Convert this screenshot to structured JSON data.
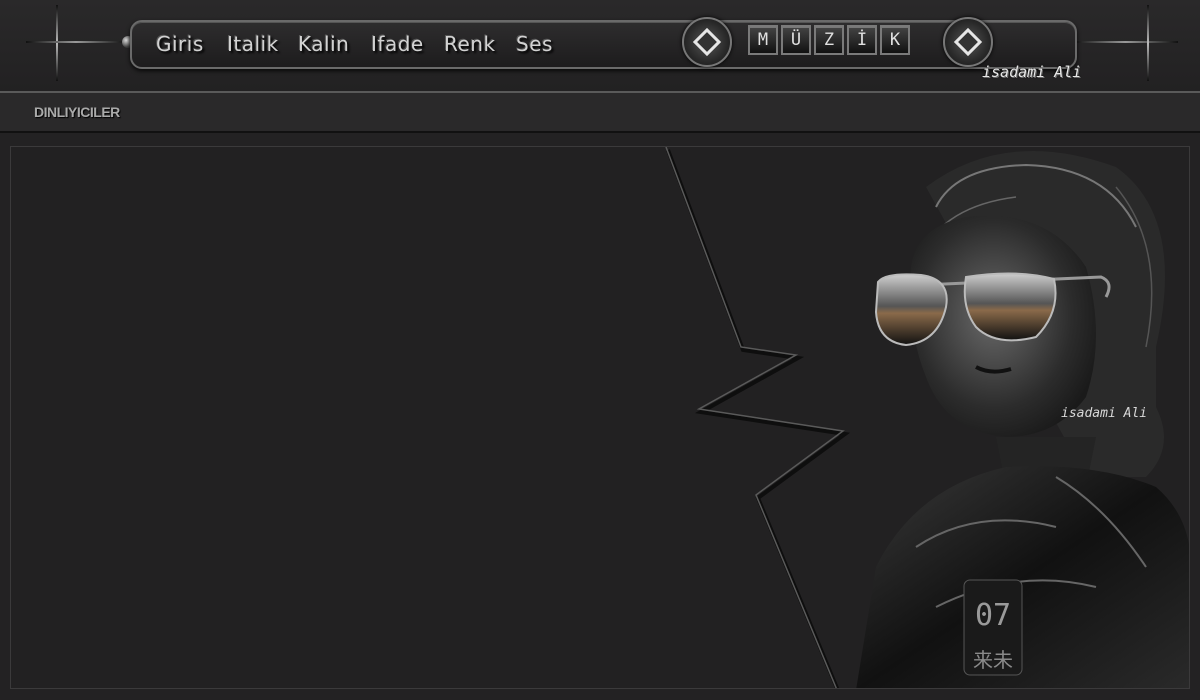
{
  "nav": {
    "items": [
      "Giris",
      "Italik",
      "Kalin",
      "Ifade",
      "Renk",
      "Ses"
    ]
  },
  "music": {
    "letters": [
      "M",
      "Ü",
      "Z",
      "İ",
      "K"
    ]
  },
  "signature": {
    "text": "isadami Ali"
  },
  "subheader": {
    "title": "DINLIYICILER"
  },
  "photo": {
    "badge_number": "07",
    "badge_chars": "来未",
    "watermark": "isadami Ali"
  },
  "colors": {
    "background": "#232223",
    "nav_text": "#d2d2d2",
    "frame": "#6a6a6a"
  }
}
